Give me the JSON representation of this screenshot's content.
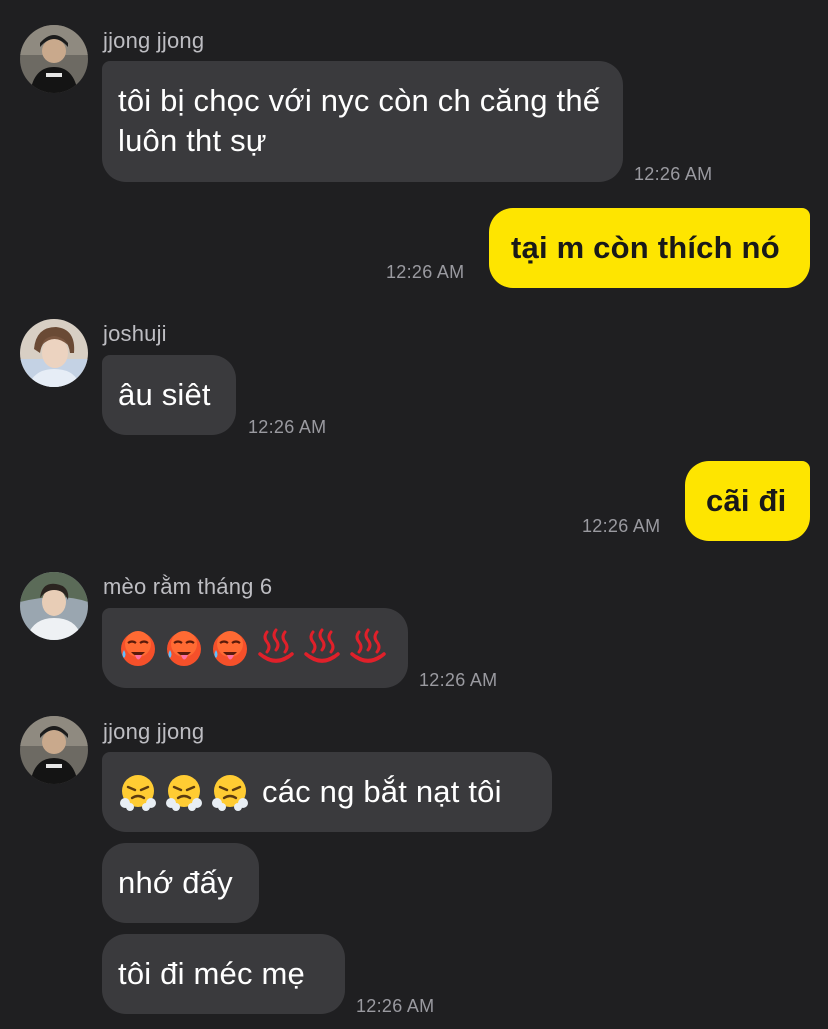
{
  "messages": [
    {
      "sender": "jjong jjong",
      "text": "tôi bị chọc với nyc còn ch căng thế luôn tht sự",
      "time": "12:26 AM"
    },
    {
      "text": "tại m còn thích nó",
      "time": "12:26 AM"
    },
    {
      "sender": "joshuji",
      "text": "âu siêt",
      "time": "12:26 AM"
    },
    {
      "text": "cãi đi",
      "time": "12:26 AM"
    },
    {
      "sender": "mèo rằm tháng 6",
      "emojis": [
        "hot-face",
        "hot-face",
        "hot-face",
        "hot-springs",
        "hot-springs",
        "hot-springs"
      ],
      "time": "12:26 AM"
    },
    {
      "sender": "jjong jjong",
      "emojis": [
        "face-with-steam",
        "face-with-steam",
        "face-with-steam"
      ],
      "text": "các ng bắt nạt tôi"
    },
    {
      "text": "nhớ đấy"
    },
    {
      "text": "tôi đi méc mẹ",
      "time": "12:26 AM"
    }
  ],
  "colors": {
    "background": "#1f1f21",
    "incoming_bubble": "#3a3a3d",
    "outgoing_bubble": "#fee500",
    "timestamp": "#9a9aa0",
    "sender_name": "#bdbdc2"
  }
}
